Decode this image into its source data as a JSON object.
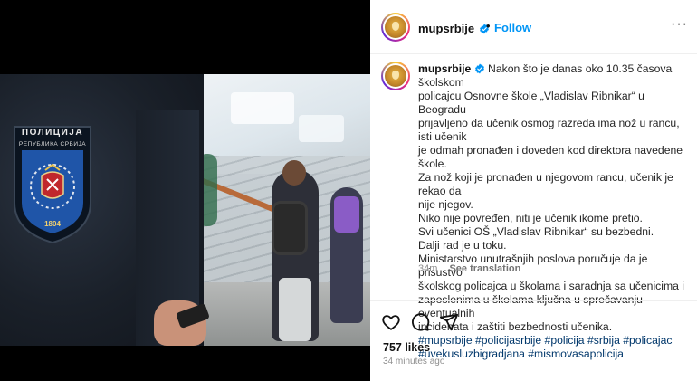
{
  "media": {
    "badge_line1": "ПОЛИЦИЈА",
    "badge_line2": "РЕПУБЛИКА СРБИЈА",
    "badge_year": "1804"
  },
  "header": {
    "username": "mupsrbije",
    "separator": "•",
    "follow_label": "Follow",
    "more_label": "···"
  },
  "caption": {
    "username": "mupsrbije",
    "lines": [
      "Nakon što je danas oko 10.35 časova školskom",
      "policajcu Osnovne škole „Vladislav Ribnikar“ u Beogradu",
      "prijavljeno da učenik osmog razreda ima nož u rancu, isti učenik",
      "je odmah pronađen i doveden kod direktora navedene škole.",
      "Za nož koji je pronađen u njegovom rancu, učenik je rekao da",
      "nije njegov.",
      "Niko nije povređen, niti je učenik ikome pretio.",
      "Svi učenici OŠ „Vladislav Ribnikar“ su bezbedni.",
      "Dalji rad je u toku.",
      "Ministarstvo unutrašnjih poslova poručuje da je prisustvo",
      "školskog policajca u školama i saradnja sa učenicima i",
      "zaposlenima u školama ključna u sprečavanju eventualnih",
      "incidenata i zaštiti bezbednosti učenika."
    ],
    "hashtags_line1": "#mupsrbije #policijasrbije #policija #srbija #policajac",
    "hashtags_line2": "#uvekusluzbigradjana #mismovasapolicija",
    "age": "34m",
    "see_translation": "See translation"
  },
  "actions": {
    "icons": [
      "heart-icon",
      "comment-icon",
      "share-icon"
    ],
    "likes": "757 likes",
    "time_ago": "34 minutes ago"
  },
  "colors": {
    "link": "#0095f6",
    "hashtag": "#00376b",
    "verified": "#0095f6"
  }
}
